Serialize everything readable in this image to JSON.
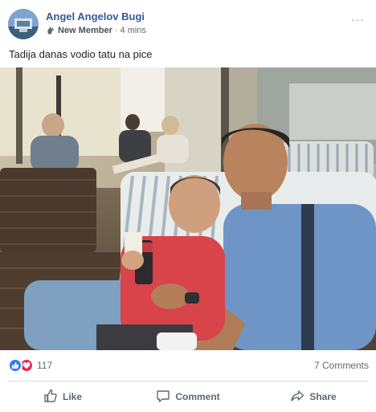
{
  "post": {
    "author": "Angel Angelov Bugi",
    "badge": "New Member",
    "separator": "·",
    "time": "4 mins",
    "text": "Tadija danas vodio tatu na pice",
    "more": "···"
  },
  "reactions": {
    "count": "117",
    "comments": "7 Comments"
  },
  "actions": {
    "like": "Like",
    "comment": "Comment",
    "share": "Share"
  },
  "icons": {
    "avatar": "avatar-image",
    "badge": "new-member-wave-icon",
    "like_reaction": "thumbs-up-icon",
    "love_reaction": "heart-icon",
    "like": "thumbs-up-outline-icon",
    "comment": "speech-bubble-icon",
    "share": "share-arrow-icon"
  },
  "colors": {
    "name": "#365899",
    "like": "#2f7bf5",
    "love": "#f0284a",
    "muted": "#616770"
  }
}
